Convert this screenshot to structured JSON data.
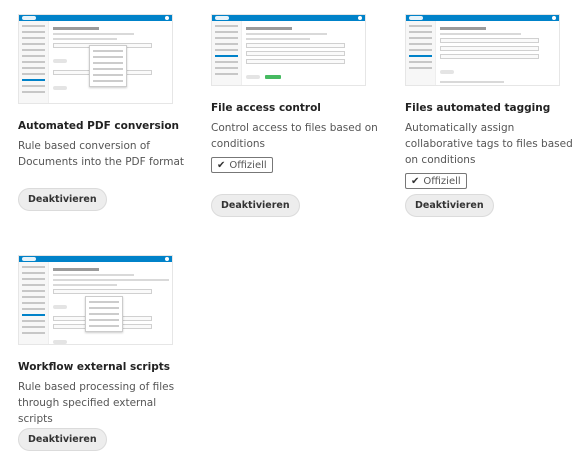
{
  "apps": [
    {
      "title": "Automated PDF conversion",
      "description": "Rule based conversion of Documents into the PDF format",
      "official_label": "",
      "button_label": "Deaktivieren"
    },
    {
      "title": "File access control",
      "description": "Control access to files based on conditions",
      "official_label": "Offiziell",
      "button_label": "Deaktivieren"
    },
    {
      "title": "Files automated tagging",
      "description": "Automatically assign collaborative tags to files based on conditions",
      "official_label": "Offiziell",
      "button_label": "Deaktivieren"
    },
    {
      "title": "Workflow external scripts",
      "description": "Rule based processing of files through specified external scripts",
      "official_label": "",
      "button_label": "Deaktivieren"
    }
  ],
  "icons": {
    "official": "check-icon"
  },
  "colors": {
    "accent": "#0082c9",
    "success": "#46ba61"
  }
}
